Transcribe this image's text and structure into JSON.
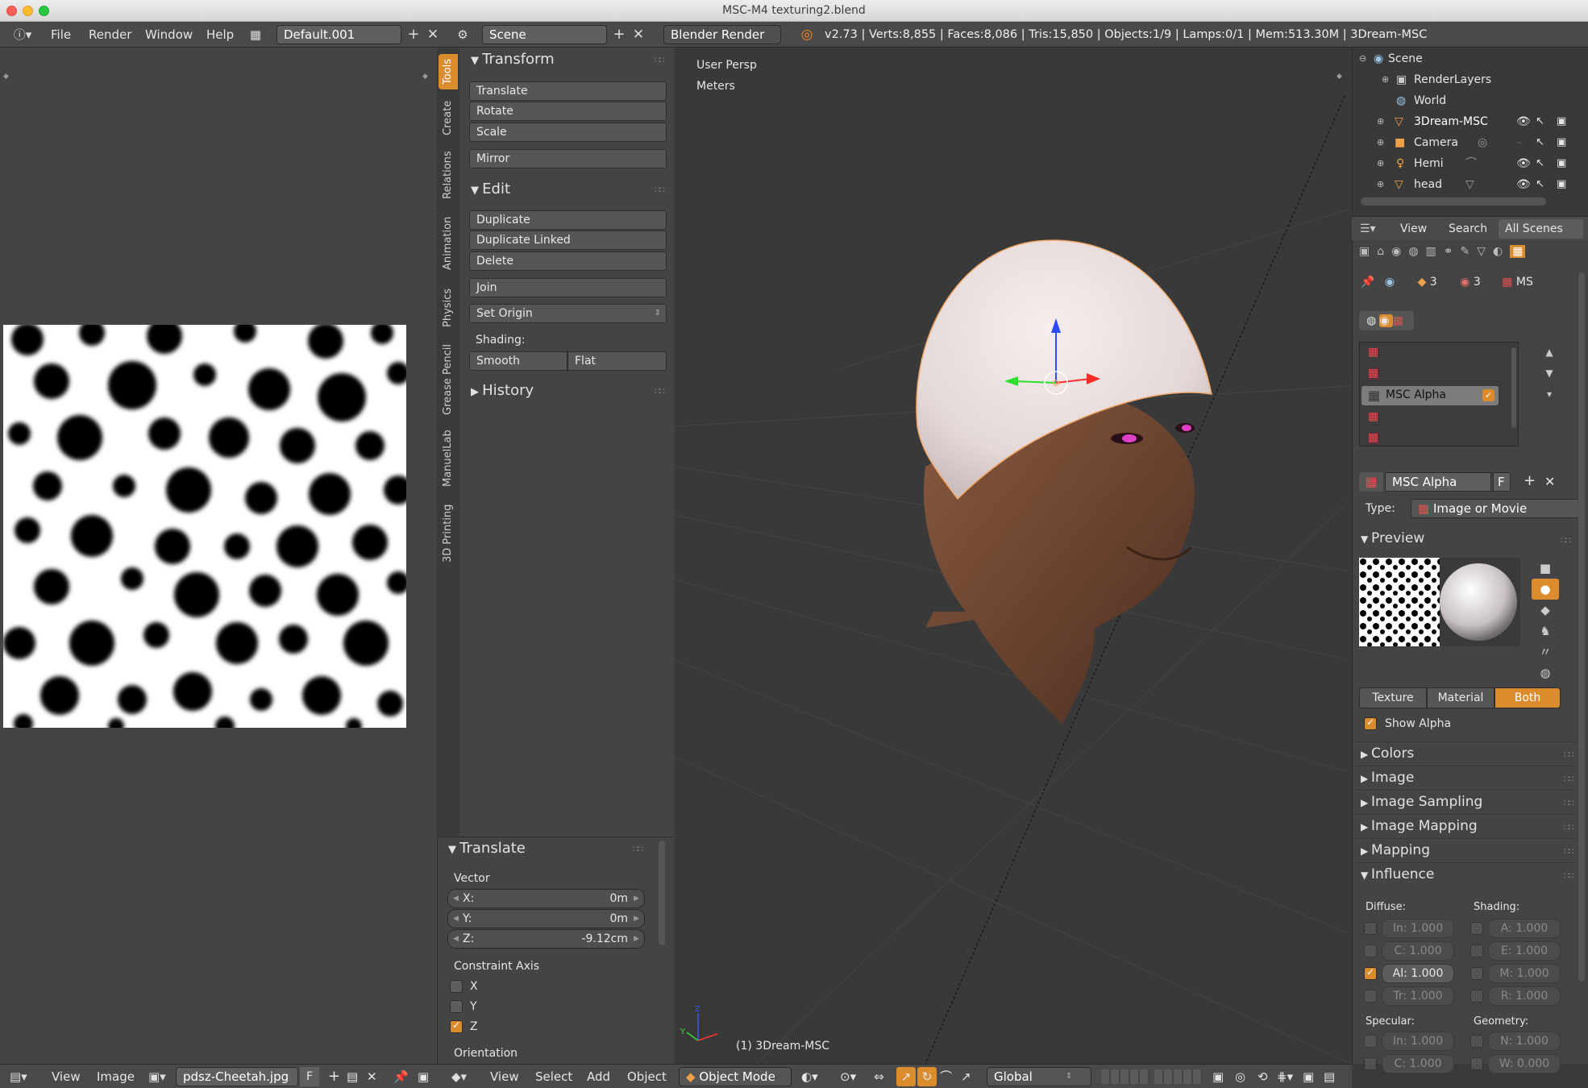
{
  "window": {
    "title": "MSC-M4 texturing2.blend"
  },
  "topbar": {
    "menus": [
      "File",
      "Render",
      "Window",
      "Help"
    ],
    "layout": "Default.001",
    "scene": "Scene",
    "engine": "Blender Render",
    "stats": "v2.73 | Verts:8,855 | Faces:8,086 | Tris:15,850 | Objects:1/9 | Lamps:0/1 | Mem:513.30M | 3Dream-MSC"
  },
  "toolshelf": {
    "tabs": [
      "Tools",
      "Create",
      "Relations",
      "Animation",
      "Physics",
      "Grease Pencil",
      "ManuelLab",
      "3D Printing"
    ],
    "transform": {
      "title": "Transform",
      "buttons": [
        "Translate",
        "Rotate",
        "Scale",
        "Mirror"
      ]
    },
    "edit": {
      "title": "Edit",
      "buttons": [
        "Duplicate",
        "Duplicate Linked",
        "Delete",
        "Join"
      ],
      "set_origin": "Set Origin",
      "shading_label": "Shading:",
      "smooth": "Smooth",
      "flat": "Flat"
    },
    "history": {
      "title": "History"
    }
  },
  "operator": {
    "title": "Translate",
    "vector_label": "Vector",
    "x_label": "X:",
    "x": "0m",
    "y_label": "Y:",
    "y": "0m",
    "z_label": "Z:",
    "z": "-9.12cm",
    "constraint_label": "Constraint Axis",
    "axes": [
      {
        "label": "X",
        "checked": false
      },
      {
        "label": "Y",
        "checked": false
      },
      {
        "label": "Z",
        "checked": true
      }
    ],
    "orientation_label": "Orientation"
  },
  "viewport": {
    "view_name": "User Persp",
    "units": "Meters",
    "object_label": "(1) 3Dream-MSC"
  },
  "outliner": {
    "items": [
      "Scene",
      "RenderLayers",
      "World",
      "3Dream-MSC",
      "Camera",
      "Hemi",
      "head"
    ],
    "tabs": {
      "view": "View",
      "search": "Search",
      "scenes": "All Scenes"
    }
  },
  "props": {
    "users_a": "3",
    "users_b": "3",
    "ms": "MS",
    "slot_selected": "MSC Alpha",
    "texture_name": "MSC Alpha",
    "fake": "F",
    "type_label": "Type:",
    "type_value": "Image or Movie",
    "preview_title": "Preview",
    "preview_tabs": {
      "texture": "Texture",
      "material": "Material",
      "both": "Both"
    },
    "show_alpha": "Show Alpha",
    "panels": [
      "Colors",
      "Image",
      "Image Sampling",
      "Image Mapping",
      "Mapping"
    ],
    "influence_title": "Influence",
    "diffuse_label": "Diffuse:",
    "shading_label": "Shading:",
    "diffuse": [
      {
        "label": "In: 1.000",
        "on": false
      },
      {
        "label": "C: 1.000",
        "on": false
      },
      {
        "label": "Al: 1.000",
        "on": true
      },
      {
        "label": "Tr: 1.000",
        "on": false
      }
    ],
    "shading": [
      {
        "label": "A: 1.000"
      },
      {
        "label": "E: 1.000"
      },
      {
        "label": "M: 1.000"
      },
      {
        "label": "R: 1.000"
      }
    ],
    "specular_label": "Specular:",
    "geometry_label": "Geometry:",
    "specular": [
      {
        "label": "In: 1.000"
      },
      {
        "label": "C: 1.000"
      }
    ],
    "geometry": [
      {
        "label": "N: 1.000"
      },
      {
        "label": "W: 0.000"
      }
    ]
  },
  "bottom_left": {
    "view": "View",
    "image": "Image",
    "image_name": "pdsz-Cheetah.jpg",
    "f": "F"
  },
  "bottom_3d": {
    "view": "View",
    "select": "Select",
    "add": "Add",
    "object": "Object",
    "mode": "Object Mode",
    "orientation": "Global"
  },
  "colors": {
    "accent": "#db8d2e",
    "header": "#4a4a4a",
    "panel": "#444444",
    "viewport": "#393939"
  }
}
